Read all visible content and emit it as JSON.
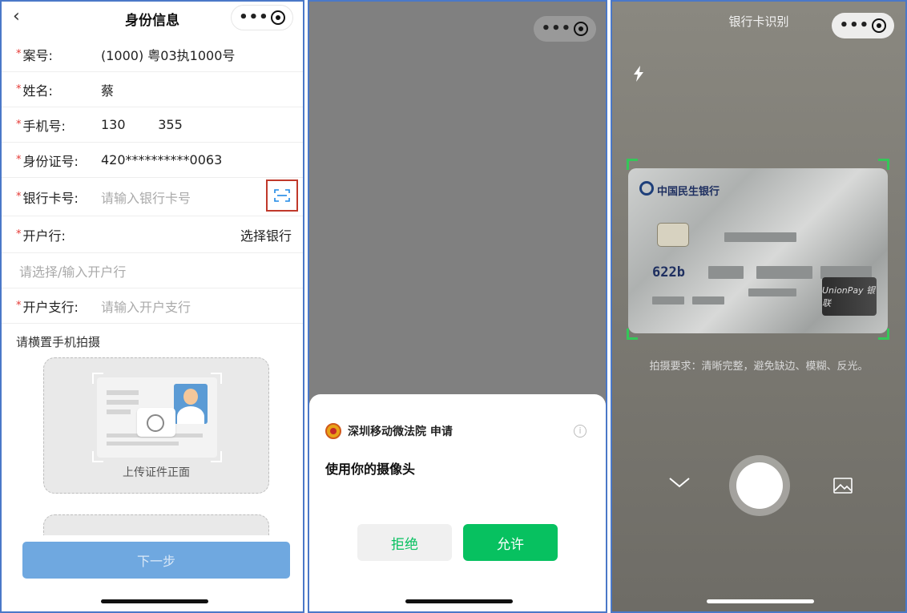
{
  "panel1": {
    "nav": {
      "title": "身份信息",
      "capsule_dots": "•••"
    },
    "rows": [
      {
        "label": "案号:",
        "value": "(1000) 粤03执1000号"
      },
      {
        "label": "姓名:",
        "value": "蔡"
      },
      {
        "label": "手机号:",
        "value": "130        355"
      },
      {
        "label": "身份证号:",
        "value": "420**********0063"
      },
      {
        "label": "银行卡号:",
        "placeholder": "请输入银行卡号"
      },
      {
        "label": "开户行:",
        "select": "选择银行"
      },
      {
        "placeholder": "请选择/输入开户行"
      },
      {
        "label": "开户支行:",
        "placeholder": "请输入开户支行"
      }
    ],
    "required_mark": "*",
    "hint": "请横置手机拍摄",
    "upload_front_label": "上传证件正面",
    "next_button": "下一步"
  },
  "panel2": {
    "capsule_dots": "•••",
    "sheet": {
      "applicant": "深圳移动微法院 申请",
      "info_glyph": "i",
      "title": "使用你的摄像头",
      "reject": "拒绝",
      "allow": "允许"
    }
  },
  "panel3": {
    "title": "银行卡识别",
    "capsule_dots": "•••",
    "card": {
      "bank_name": "中国民生银行",
      "number_prefix": "622b",
      "network": "UnionPay 银联"
    },
    "hint": "拍摄要求：清晰完整，避免缺边、模糊、反光。"
  },
  "colors": {
    "required": "#e53935",
    "scan_icon": "#1e88e5",
    "highlight_box": "#c0392b",
    "next_button": "#6fa8e0",
    "wechat_green": "#07c160",
    "frame_corner": "#34c759",
    "panel_border": "#4a78c8"
  },
  "icons": [
    "back-icon",
    "more-dots-icon",
    "target-icon",
    "scan-icon",
    "camera-icon",
    "avatar-icon",
    "court-logo-icon",
    "info-icon",
    "flash-icon",
    "chevron-down-icon",
    "shutter-icon",
    "gallery-icon"
  ]
}
